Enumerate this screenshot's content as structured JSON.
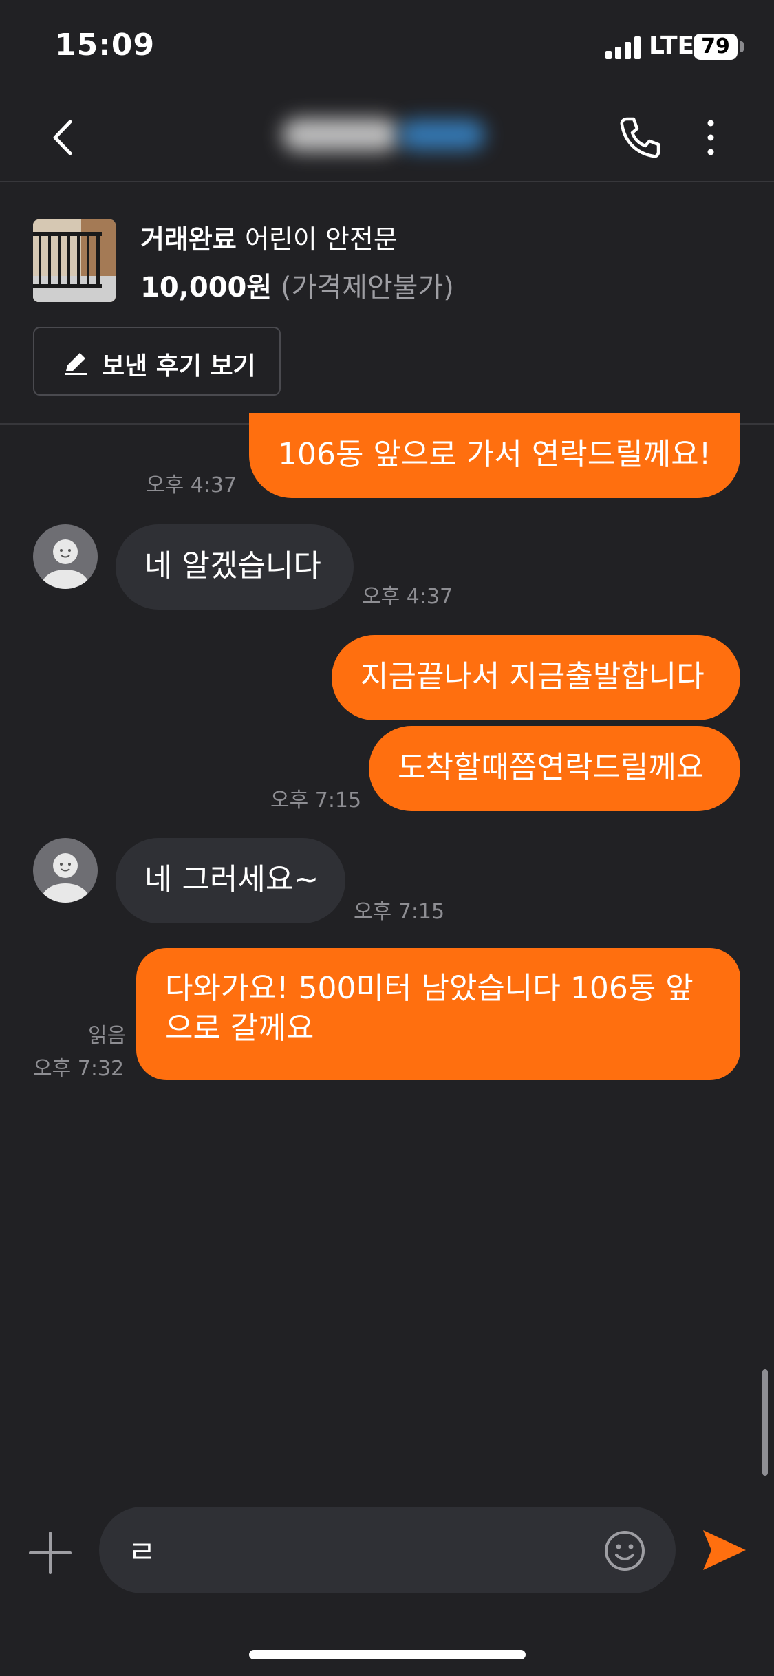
{
  "status_bar": {
    "time": "15:09",
    "network": "LTE",
    "battery": "79"
  },
  "header": {
    "title_blurred": ""
  },
  "product": {
    "status": "거래완료",
    "name": "어린이 안전문",
    "price": "10,000원",
    "price_note": "(가격제안불가)",
    "review_button": "보낸 후기 보기"
  },
  "messages": [
    {
      "sender": "me",
      "text": "106동 앞으로 가서 연락드릴께요!",
      "time": "오후 4:37"
    },
    {
      "sender": "them",
      "text": "네 알겠습니다",
      "time": "오후 4:37"
    },
    {
      "sender": "me",
      "text": "지금끝나서 지금출발합니다",
      "time": ""
    },
    {
      "sender": "me",
      "text": "도착할때쯤연락드릴께요",
      "time": "오후 7:15"
    },
    {
      "sender": "them",
      "text": "네 그러세요~",
      "time": "오후 7:15"
    },
    {
      "sender": "me",
      "text": "다와가요! 500미터 남았습니다 106동 앞으로 갈께요",
      "time": "오후 7:32",
      "read": "읽음"
    }
  ],
  "input": {
    "value": "ㄹ"
  },
  "colors": {
    "accent": "#ff6f0f",
    "background": "#212124",
    "bubble_other": "#2f3035"
  },
  "icons": [
    "back-icon",
    "phone-icon",
    "more-vertical-icon",
    "pencil-icon",
    "plus-icon",
    "emoji-icon",
    "send-icon"
  ]
}
